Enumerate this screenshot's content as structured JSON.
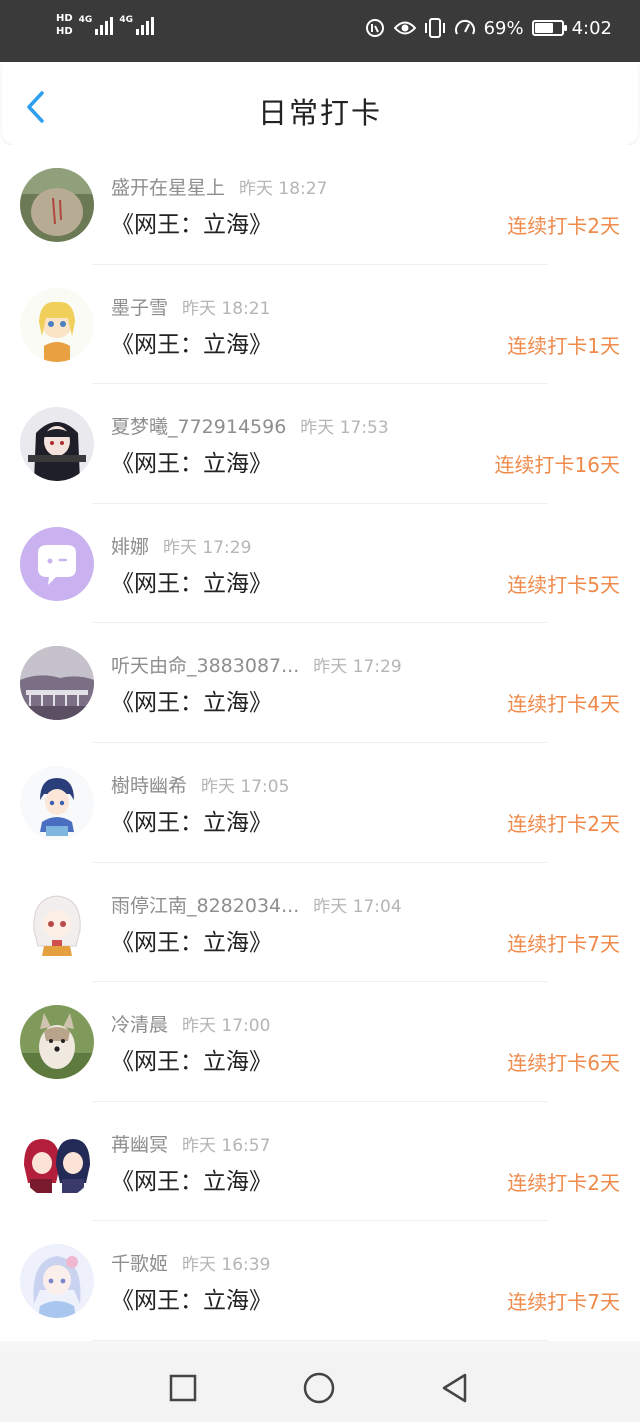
{
  "status_bar": {
    "hd1": "HD",
    "hd2": "HD",
    "net1": "4G",
    "net2": "4G",
    "battery_pct": "69%",
    "battery_level": 0.69,
    "time": "4:02",
    "icons": [
      "nfc-icon",
      "eye-comfort-icon",
      "vibrate-icon",
      "speed-icon"
    ]
  },
  "header": {
    "back_icon": "chevron-left-icon",
    "title": "日常打卡"
  },
  "accent_colors": {
    "back": "#2d9ef0",
    "streak": "#ef8a4a"
  },
  "checkins": [
    {
      "name": "盛开在星星上",
      "time": "昨天 18:27",
      "book": "《网王：立海》",
      "streak": "连续打卡2天",
      "avatar": "rock-photo"
    },
    {
      "name": "墨子雪",
      "time": "昨天 18:21",
      "book": "《网王：立海》",
      "streak": "连续打卡1天",
      "avatar": "anime-blonde-girl"
    },
    {
      "name": "夏梦曦_772914596",
      "time": "昨天 17:53",
      "book": "《网王：立海》",
      "streak": "连续打卡16天",
      "avatar": "anime-dark-girl"
    },
    {
      "name": "婔娜",
      "time": "昨天 17:29",
      "book": "《网王：立海》",
      "streak": "连续打卡5天",
      "avatar": "default-chat-avatar"
    },
    {
      "name": "听天由命_3883087...",
      "time": "昨天 17:29",
      "book": "《网王：立海》",
      "streak": "连续打卡4天",
      "avatar": "bridge-photo"
    },
    {
      "name": "樹時幽希",
      "time": "昨天 17:05",
      "book": "《网王：立海》",
      "streak": "连续打卡2天",
      "avatar": "anime-boy"
    },
    {
      "name": "雨停江南_8282034...",
      "time": "昨天 17:04",
      "book": "《网王：立海》",
      "streak": "连续打卡7天",
      "avatar": "anime-white-hair"
    },
    {
      "name": "冷清晨",
      "time": "昨天 17:00",
      "book": "《网王：立海》",
      "streak": "连续打卡6天",
      "avatar": "puppy-photo"
    },
    {
      "name": "苒幽冥",
      "time": "昨天 16:57",
      "book": "《网王：立海》",
      "streak": "连续打卡2天",
      "avatar": "anime-pair"
    },
    {
      "name": "千歌姬",
      "time": "昨天 16:39",
      "book": "《网王：立海》",
      "streak": "连续打卡7天",
      "avatar": "anime-pastel-girl"
    }
  ],
  "nav_bar": {
    "buttons": [
      "recent-apps-square-icon",
      "home-circle-icon",
      "back-triangle-icon"
    ]
  }
}
